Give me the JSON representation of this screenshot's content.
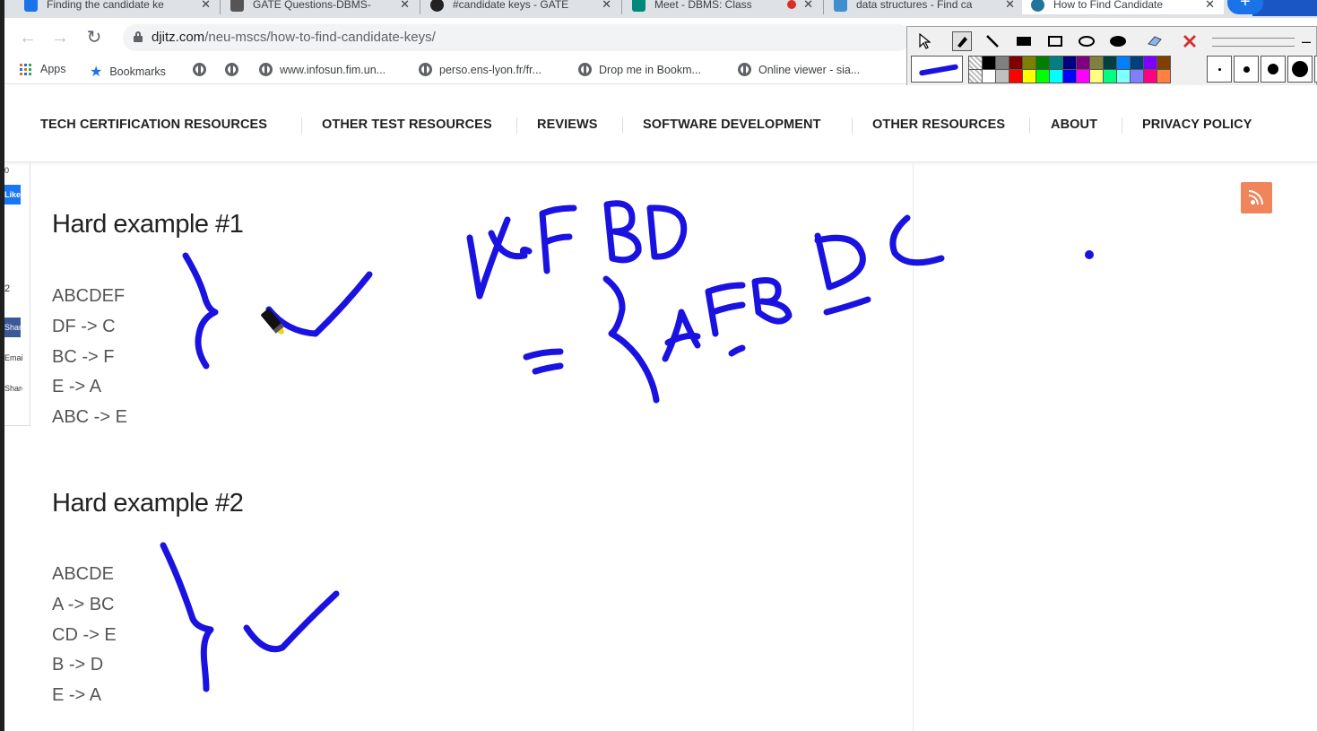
{
  "browser": {
    "tabs": [
      {
        "title": "Finding the candidate ke",
        "icon_color": "#1a73e8",
        "icon": "leetcode-icon"
      },
      {
        "title": "GATE Questions-DBMS-",
        "icon_color": "#555555",
        "icon": "p-icon"
      },
      {
        "title": "#candidate keys - GATE",
        "icon_color": "#222222",
        "icon": "gate-icon"
      },
      {
        "title": "Meet - DBMS: Class",
        "icon_color": "#00897b",
        "icon": "meet-icon"
      },
      {
        "title": "data structures - Find ca",
        "icon_color": "#3f8fcf",
        "icon": "stackexchange-icon"
      },
      {
        "title": "How to Find Candidate",
        "icon_color": "#21759b",
        "icon": "wordpress-icon"
      }
    ],
    "url_host": "djitz.com",
    "url_path": "/neu-mscs/how-to-find-candidate-keys/",
    "bookmarks": [
      {
        "label": "Apps",
        "icon": "apps-icon"
      },
      {
        "label": "Bookmarks",
        "icon": "star-icon"
      },
      {
        "label": "",
        "icon": "globe-icon"
      },
      {
        "label": "",
        "icon": "globe-icon"
      },
      {
        "label": "www.infosun.fim.un...",
        "icon": "globe-icon"
      },
      {
        "label": "perso.ens-lyon.fr/fr...",
        "icon": "globe-icon"
      },
      {
        "label": "Drop me in Bookm...",
        "icon": "globe-icon"
      },
      {
        "label": "Online viewer - sia...",
        "icon": "globe-icon"
      }
    ]
  },
  "annotation_toolbar": {
    "tools": [
      "pointer-icon",
      "pen-icon",
      "line-icon",
      "filled-rect-icon",
      "rect-icon",
      "ellipse-icon",
      "filled-ellipse-icon",
      "eraser-icon",
      "clear-icon"
    ],
    "active_tool": "pen-icon",
    "current_color": "#1a12e0",
    "palette": [
      "#000000",
      "#808080",
      "#800000",
      "#808000",
      "#008000",
      "#008080",
      "#000080",
      "#800080",
      "#808040",
      "#004040",
      "#0080ff",
      "#004080",
      "#8000ff",
      "#804000",
      "#ffffff",
      "#c0c0c0",
      "#ff0000",
      "#ffff00",
      "#00ff00",
      "#00ffff",
      "#0000ff",
      "#ff00ff",
      "#ffff80",
      "#00ff80",
      "#80ffff",
      "#8080ff",
      "#ff0080",
      "#ff8040"
    ]
  },
  "site_nav": {
    "items": [
      "TECH CERTIFICATION RESOURCES",
      "OTHER TEST RESOURCES",
      "REVIEWS",
      "SOFTWARE DEVELOPMENT",
      "OTHER RESOURCES",
      "ABOUT",
      "PRIVACY POLICY"
    ]
  },
  "share_bar": {
    "like": "Like",
    "count": "2",
    "share": "Share",
    "email": "Email",
    "share2": "Share",
    "zero": "0"
  },
  "examples": [
    {
      "title": "Hard example #1",
      "lines": [
        "ABCDEF",
        "DF -> C",
        "BC -> F",
        "E -> A",
        "ABC -> E"
      ]
    },
    {
      "title": "Hard example #2",
      "lines": [
        "ABCDE",
        "A -> BC",
        "CD -> E",
        "B -> D",
        "E -> A"
      ]
    }
  ],
  "ink": {
    "color": "#1a12e0",
    "handwritten_text": [
      "AFBD",
      "= {AFBDC"
    ]
  },
  "rss": {
    "icon": "rss-icon",
    "color": "#f0845a"
  }
}
